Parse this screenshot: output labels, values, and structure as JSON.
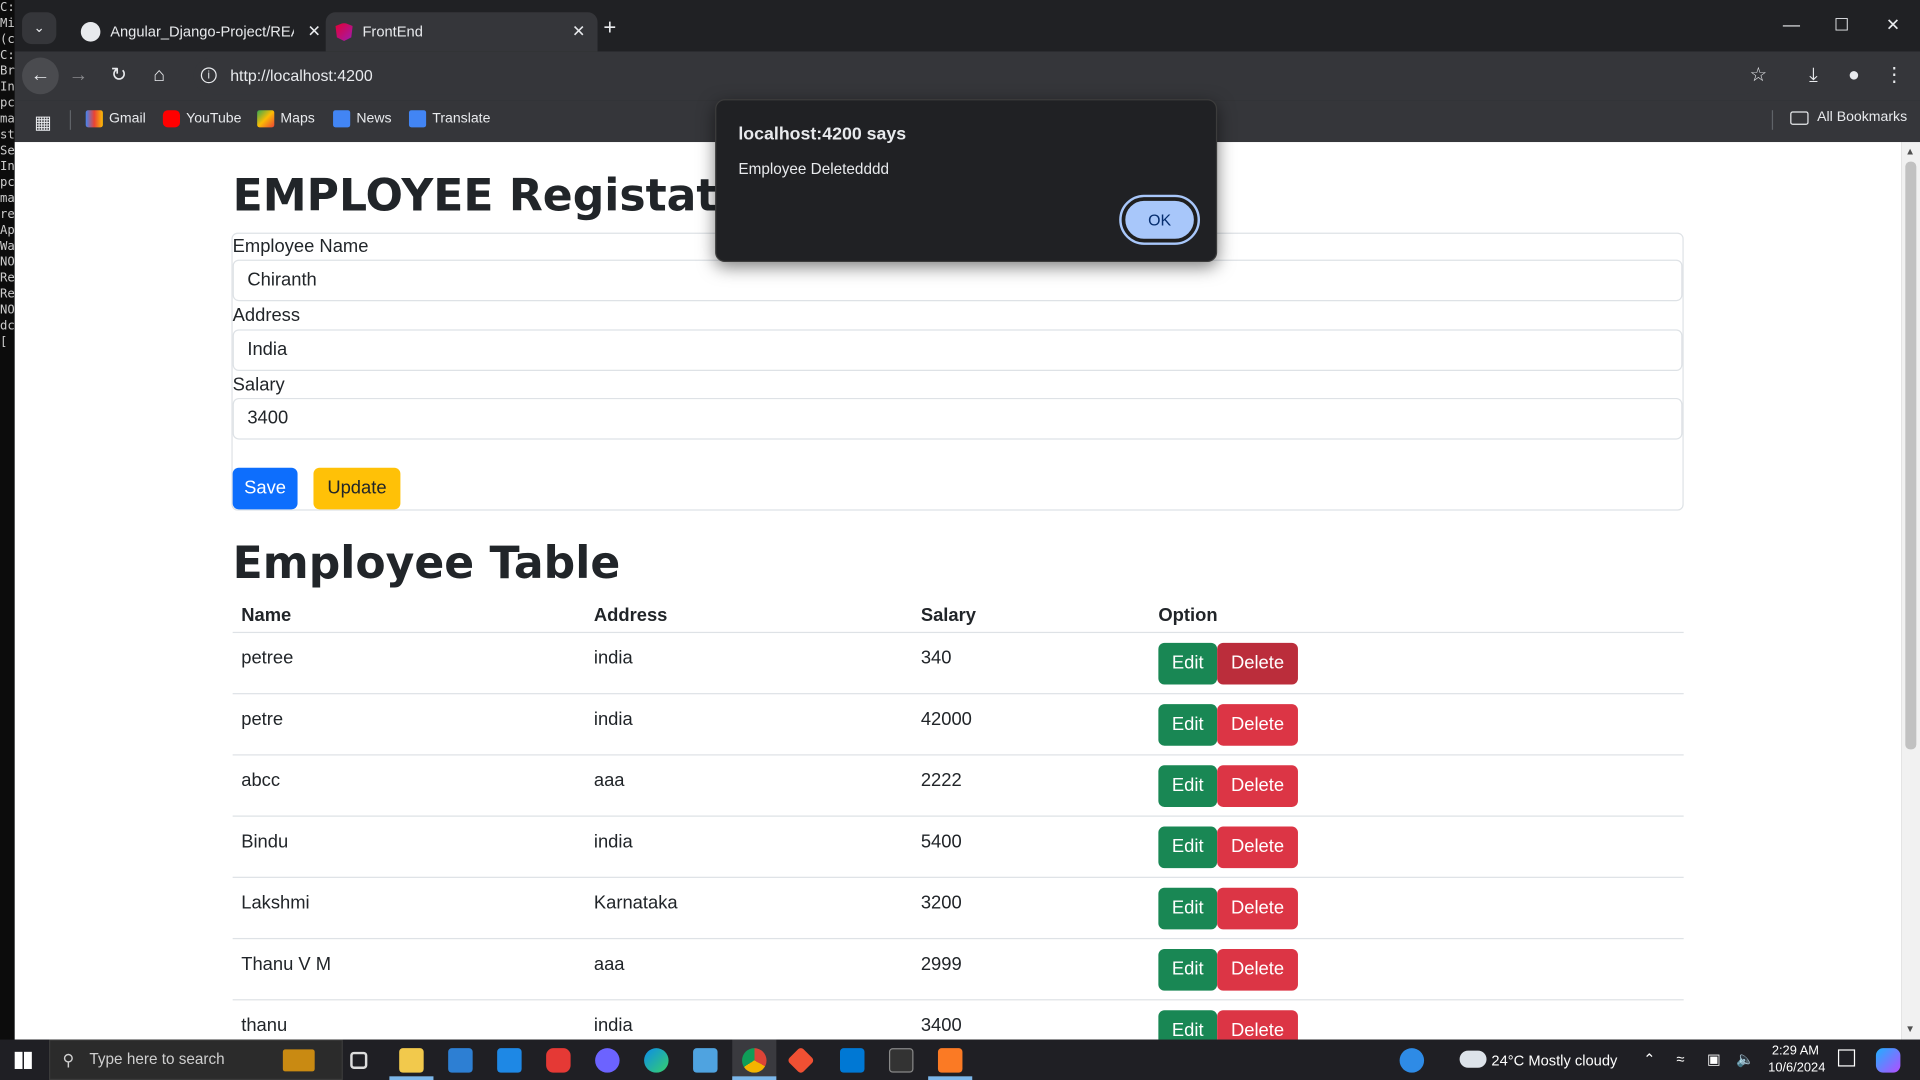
{
  "browser": {
    "tabs": [
      {
        "title": "Angular_Django-Project/READM"
      },
      {
        "title": "FrontEnd"
      }
    ],
    "url": "http://localhost:4200",
    "bookmarks": [
      "Gmail",
      "YouTube",
      "Maps",
      "News",
      "Translate"
    ],
    "all_bookmarks": "All Bookmarks"
  },
  "terminal": {
    "lines": [
      "C:\\",
      "Mi",
      "(c",
      "",
      "C:",
      "Br",
      "In",
      "pc",
      "ma",
      "st",
      "",
      "",
      "",
      "",
      "Se",
      "In",
      "pc",
      "ma",
      "re",
      "",
      "Ap",
      "",
      "Wa",
      "NO",
      "Re",
      "",
      "",
      "Re",
      "NO",
      "dc",
      "["
    ]
  },
  "page": {
    "form_title": "EMPLOYEE Registation",
    "fields": [
      {
        "label": "Employee Name",
        "value": "Chiranth"
      },
      {
        "label": "Address",
        "value": "India"
      },
      {
        "label": "Salary",
        "value": "3400"
      }
    ],
    "save_label": "Save",
    "update_label": "Update",
    "table_title": "Employee Table",
    "columns": [
      "Name",
      "Address",
      "Salary",
      "Option"
    ],
    "rows": [
      {
        "name": "petree",
        "address": "india",
        "salary": "340"
      },
      {
        "name": "petre",
        "address": "india",
        "salary": "42000"
      },
      {
        "name": "abcc",
        "address": "aaa",
        "salary": "2222"
      },
      {
        "name": "Bindu",
        "address": "india",
        "salary": "5400"
      },
      {
        "name": "Lakshmi",
        "address": "Karnataka",
        "salary": "3200"
      },
      {
        "name": "Thanu V M",
        "address": "aaa",
        "salary": "2999"
      },
      {
        "name": "thanu",
        "address": "india",
        "salary": "3400"
      }
    ],
    "edit_label": "Edit",
    "delete_label": "Delete"
  },
  "dialog": {
    "title": "localhost:4200 says",
    "message": "Employee Deletedddd",
    "ok_label": "OK"
  },
  "taskbar": {
    "search_placeholder": "Type here to search",
    "weather": "24°C  Mostly cloudy",
    "time": "2:29 AM",
    "date": "10/6/2024"
  },
  "colors": {
    "primary": "#0d6efd",
    "warning": "#ffc107",
    "success": "#198754",
    "danger": "#dc3545",
    "danger_hover": "#bb2d3b",
    "dialog_button": "#a8c7fa"
  }
}
